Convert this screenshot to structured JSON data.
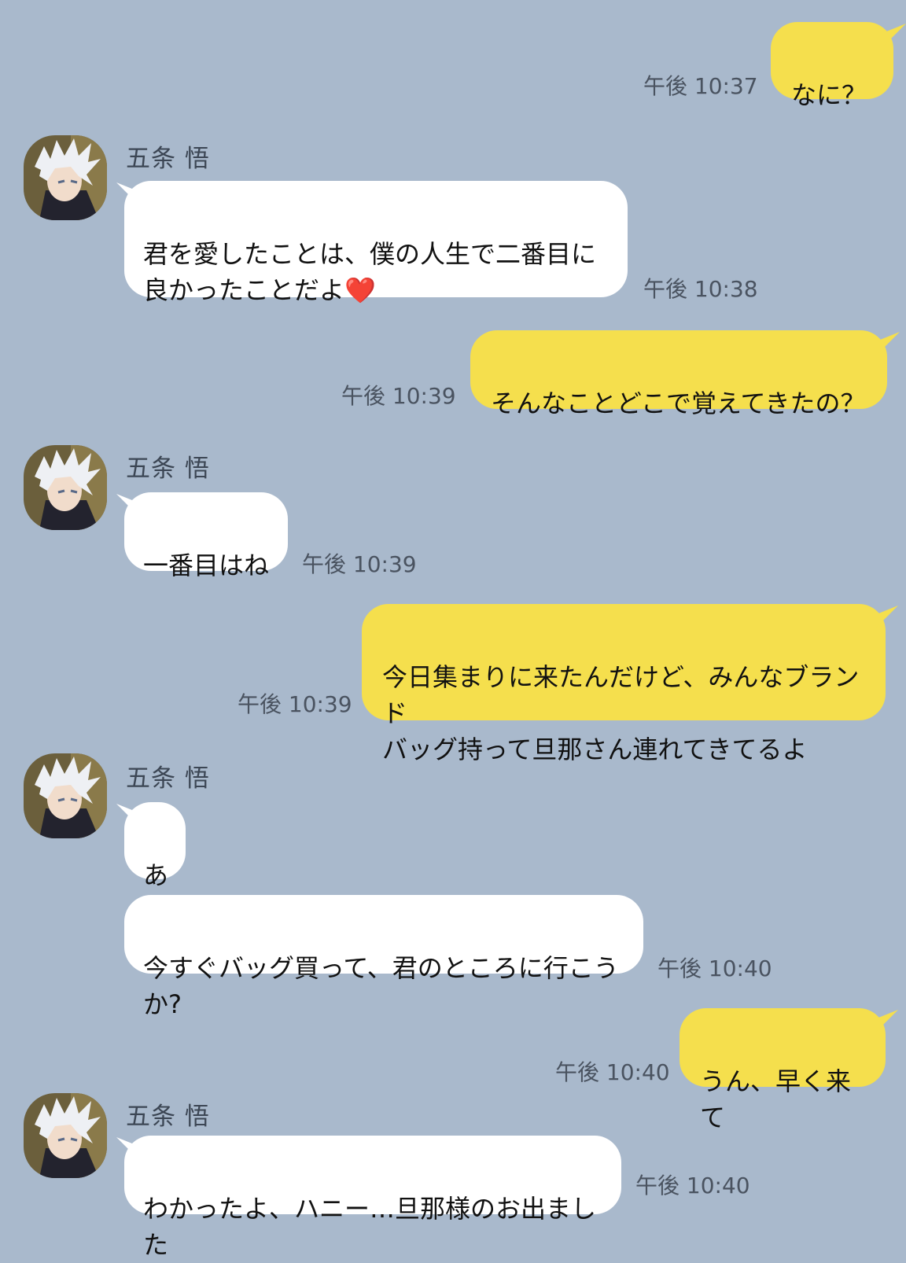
{
  "contact": {
    "name": "五条 悟",
    "avatar_icon": "anime-character-avatar-icon"
  },
  "colors": {
    "background": "#a9b9cc",
    "incoming_bubble": "#ffffff",
    "outgoing_bubble": "#f5df4d"
  },
  "messages": [
    {
      "direction": "out",
      "text": "なに？",
      "time": "午後 10:37"
    },
    {
      "direction": "in",
      "text": "君を愛したことは、僕の人生で二番目に\n良かったことだよ❤️",
      "time": "午後 10:38"
    },
    {
      "direction": "out",
      "text": "そんなことどこで覚えてきたの？",
      "time": "午後 10:39"
    },
    {
      "direction": "in",
      "text": "一番目はね",
      "time": "午後 10:39"
    },
    {
      "direction": "out",
      "text": "今日集まりに来たんだけど、みんなブランド\nバッグ持って旦那さん連れてきてるよ",
      "time": "午後 10:39"
    },
    {
      "direction": "in",
      "text": "あ",
      "time": ""
    },
    {
      "direction": "in",
      "text": "今すぐバッグ買って、君のところに行こうか?",
      "time": "午後 10:40"
    },
    {
      "direction": "out",
      "text": "うん、早く来て",
      "time": "午後 10:40"
    },
    {
      "direction": "in",
      "text": "わかったよ、ハニー…旦那様のお出ました",
      "time": "午後 10:40"
    }
  ]
}
